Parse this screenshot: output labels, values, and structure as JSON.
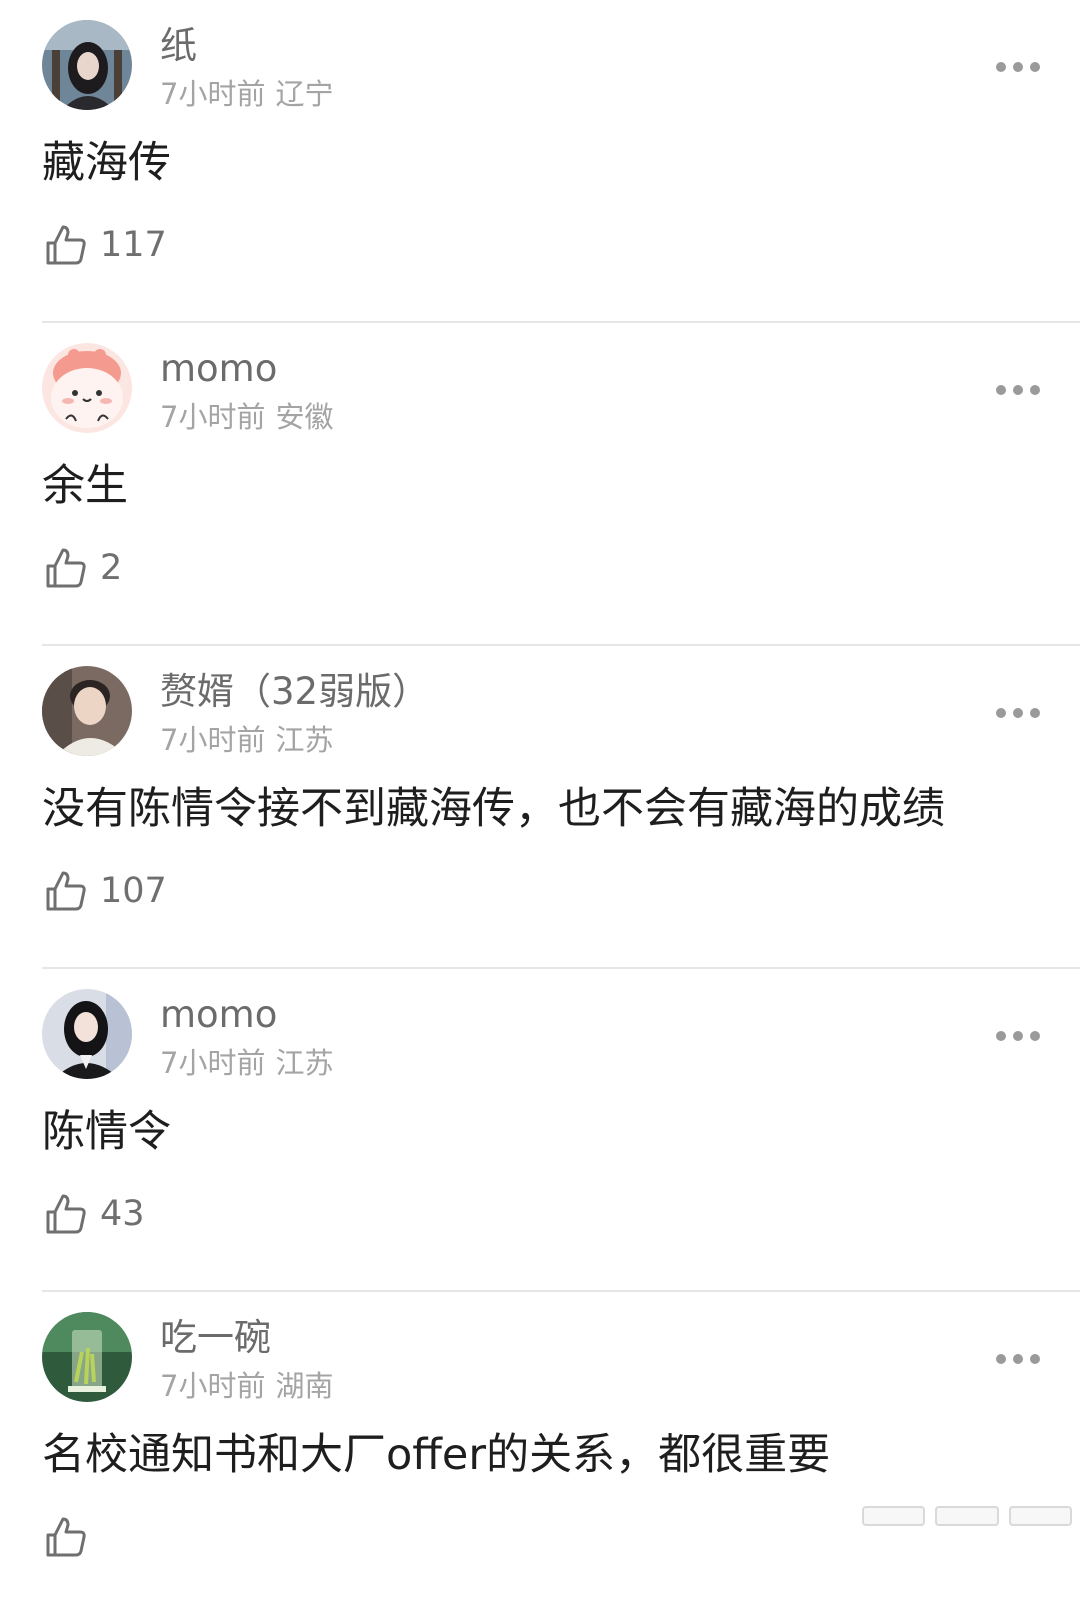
{
  "comments": [
    {
      "username": "纸",
      "time": "7小时前",
      "location": "辽宁",
      "content": "藏海传",
      "likes": "117",
      "avatar_icon": "avatar-photo-girl-dark-hair"
    },
    {
      "username": "momo",
      "time": "7小时前",
      "location": "安徽",
      "content": "余生",
      "likes": "2",
      "avatar_icon": "avatar-cartoon-pink-shrimp"
    },
    {
      "username": "赘婿（32弱版）",
      "time": "7小时前",
      "location": "江苏",
      "content": "没有陈情令接不到藏海传，也不会有藏海的成绩",
      "likes": "107",
      "avatar_icon": "avatar-photo-young-man"
    },
    {
      "username": "momo",
      "time": "7小时前",
      "location": "江苏",
      "content": "陈情令",
      "likes": "43",
      "avatar_icon": "avatar-photo-woman-black-suit"
    },
    {
      "username": "吃一碗",
      "time": "7小时前",
      "location": "湖南",
      "content": "名校通知书和大厂offer的关系，都很重要",
      "likes": "",
      "avatar_icon": "avatar-photo-green-tea-glass"
    }
  ],
  "colors": {
    "username": "#6b6b6b",
    "meta": "#a4a4a4",
    "content": "#1e1e1e",
    "divider": "#e6e6e6"
  }
}
